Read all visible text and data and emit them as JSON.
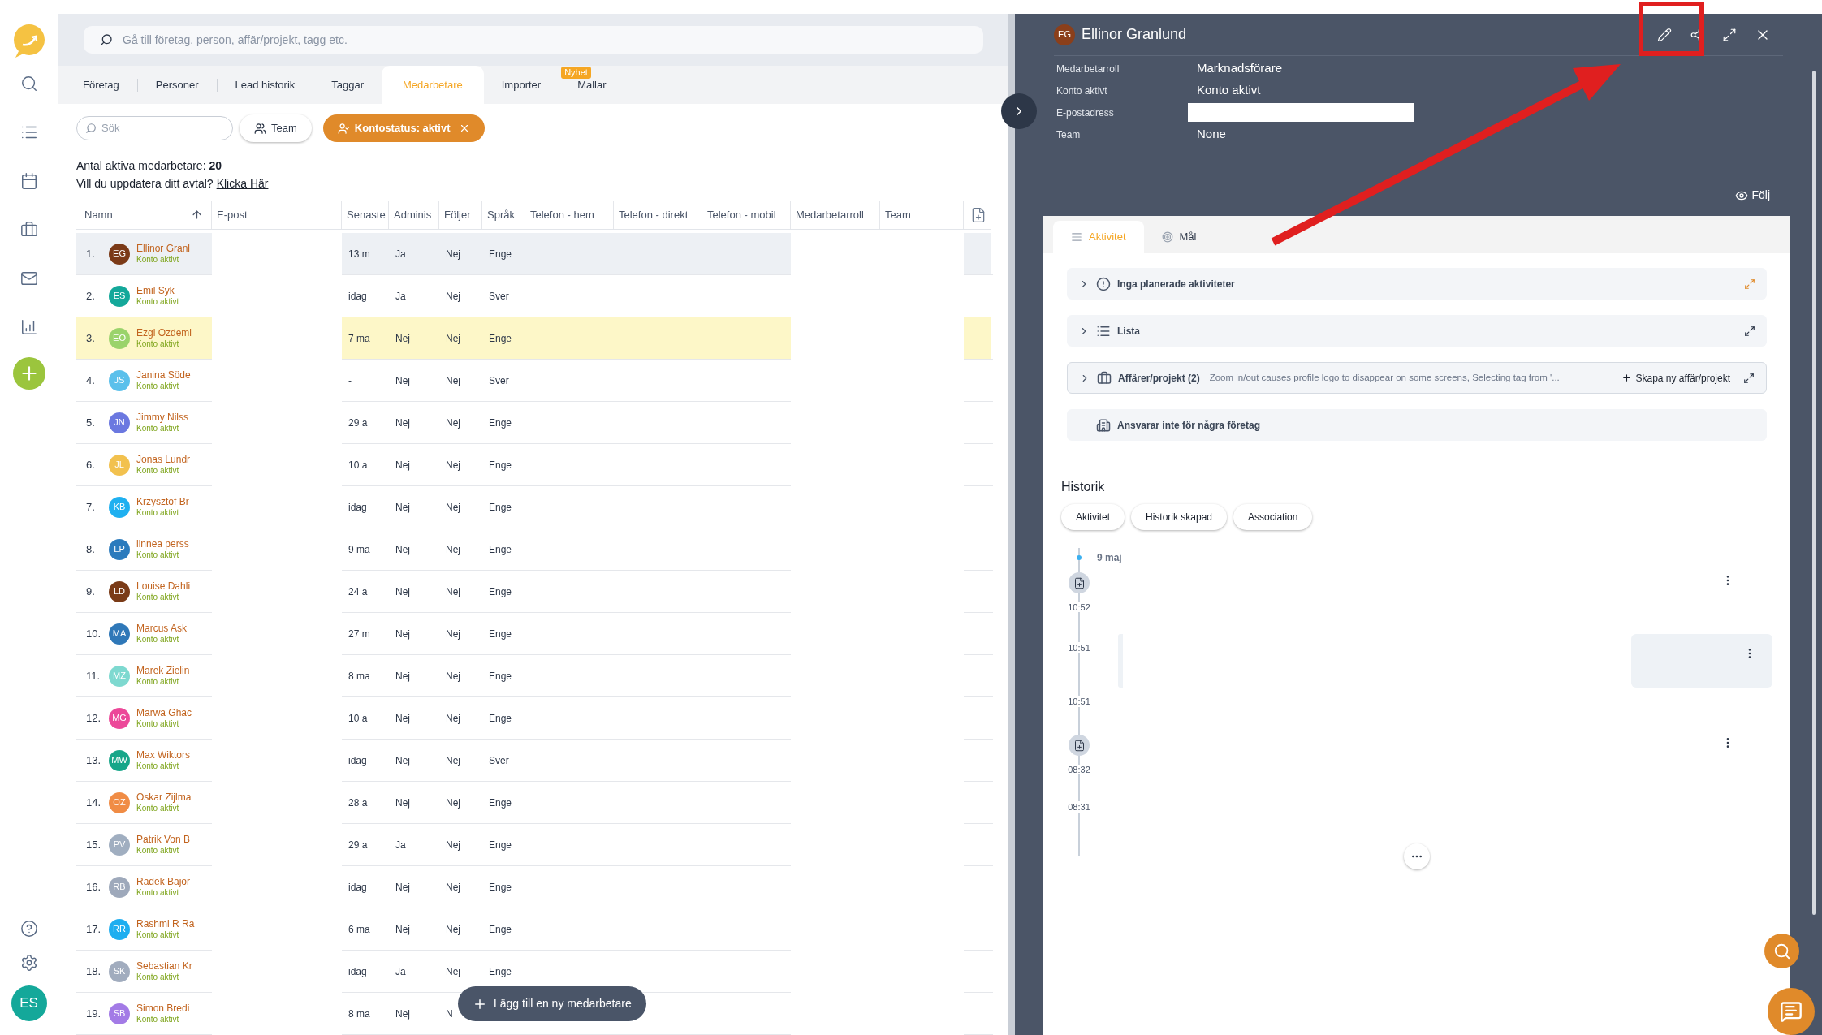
{
  "search": {
    "placeholder": "Gå till företag, person, affär/projekt, tagg etc."
  },
  "tabs": [
    {
      "label": "Företag",
      "selected": false
    },
    {
      "label": "Personer",
      "selected": false
    },
    {
      "label": "Lead historik",
      "selected": false
    },
    {
      "label": "Taggar",
      "selected": false
    },
    {
      "label": "Medarbetare",
      "selected": true
    },
    {
      "label": "Importer",
      "selected": false
    },
    {
      "label": "Mallar",
      "selected": false,
      "badge": "Nyhet"
    }
  ],
  "filters": {
    "search_placeholder": "Sök",
    "team_button": "Team",
    "status_chip": "Kontostatus: aktivt"
  },
  "summary": {
    "count": "Antal aktiva medarbetare: **20**",
    "prompt": "Vill du uppdatera ditt avtal?",
    "link": "Klicka Här"
  },
  "table": {
    "columns": [
      "Namn",
      "E-post",
      "Senaste",
      "Adminis",
      "Följer",
      "Språk",
      "Telefon - hem",
      "Telefon - direkt",
      "Telefon - mobil",
      "Medarbetarroll",
      "Team"
    ],
    "rows": [
      {
        "number": "1.",
        "initials": "EG",
        "color": "#7b3a17",
        "name": "Ellinor Granl",
        "status": "Konto aktivt",
        "last": "13 m",
        "admin": "Ja",
        "follows": "Nej",
        "language": "Enge",
        "selected": true,
        "highlighted": false
      },
      {
        "number": "2.",
        "initials": "ES",
        "color": "#14a89a",
        "name": "Emil Syk",
        "status": "Konto aktivt",
        "last": "idag",
        "admin": "Ja",
        "follows": "Nej",
        "language": "Sver",
        "selected": false,
        "highlighted": false
      },
      {
        "number": "3.",
        "initials": "EO",
        "color": "#9ad36b",
        "name": "Ezgi Ozdemi",
        "status": "Konto aktivt",
        "last": "7 ma",
        "admin": "Nej",
        "follows": "Nej",
        "language": "Enge",
        "selected": false,
        "highlighted": true
      },
      {
        "number": "4.",
        "initials": "JS",
        "color": "#5bc0eb",
        "name": "Janina Söde",
        "status": "Konto aktivt",
        "last": "-",
        "admin": "Nej",
        "follows": "Nej",
        "language": "Sver",
        "selected": false,
        "highlighted": false
      },
      {
        "number": "5.",
        "initials": "JN",
        "color": "#6b78e0",
        "name": "Jimmy Nilss",
        "status": "Konto aktivt",
        "last": "29 a",
        "admin": "Nej",
        "follows": "Nej",
        "language": "Enge",
        "selected": false,
        "highlighted": false
      },
      {
        "number": "6.",
        "initials": "JL",
        "color": "#f2c14e",
        "name": "Jonas Lundr",
        "status": "Konto aktivt",
        "last": "10 a",
        "admin": "Nej",
        "follows": "Nej",
        "language": "Enge",
        "selected": false,
        "highlighted": false
      },
      {
        "number": "7.",
        "initials": "KB",
        "color": "#1fb0f0",
        "name": "Krzysztof Br",
        "status": "Konto aktivt",
        "last": "idag",
        "admin": "Nej",
        "follows": "Nej",
        "language": "Enge",
        "selected": false,
        "highlighted": false
      },
      {
        "number": "8.",
        "initials": "LP",
        "color": "#2b7bbd",
        "name": "linnea perss",
        "status": "Konto aktivt",
        "last": "9 ma",
        "admin": "Nej",
        "follows": "Nej",
        "language": "Enge",
        "selected": false,
        "highlighted": false
      },
      {
        "number": "9.",
        "initials": "LD",
        "color": "#7a3b17",
        "name": "Louise Dahli",
        "status": "Konto aktivt",
        "last": "24 a",
        "admin": "Nej",
        "follows": "Nej",
        "language": "Enge",
        "selected": false,
        "highlighted": false
      },
      {
        "number": "10.",
        "initials": "MA",
        "color": "#2f78b8",
        "name": "Marcus Ask",
        "status": "Konto aktivt",
        "last": "27 m",
        "admin": "Nej",
        "follows": "Nej",
        "language": "Enge",
        "selected": false,
        "highlighted": false
      },
      {
        "number": "11.",
        "initials": "MZ",
        "color": "#7ed9d0",
        "name": "Marek Zielin",
        "status": "Konto aktivt",
        "last": "8 ma",
        "admin": "Nej",
        "follows": "Nej",
        "language": "Enge",
        "selected": false,
        "highlighted": false
      },
      {
        "number": "12.",
        "initials": "MG",
        "color": "#ec4899",
        "name": "Marwa Ghac",
        "status": "Konto aktivt",
        "last": "10 a",
        "admin": "Nej",
        "follows": "Nej",
        "language": "Enge",
        "selected": false,
        "highlighted": false
      },
      {
        "number": "13.",
        "initials": "MW",
        "color": "#17a689",
        "name": "Max Wiktors",
        "status": "Konto aktivt",
        "last": "idag",
        "admin": "Nej",
        "follows": "Nej",
        "language": "Sver",
        "selected": false,
        "highlighted": false
      },
      {
        "number": "14.",
        "initials": "OZ",
        "color": "#f08c45",
        "name": "Oskar Zijlma",
        "status": "Konto aktivt",
        "last": "28 a",
        "admin": "Nej",
        "follows": "Nej",
        "language": "Enge",
        "selected": false,
        "highlighted": false
      },
      {
        "number": "15.",
        "initials": "PV",
        "color": "#a0aec0",
        "name": "Patrik Von B",
        "status": "Konto aktivt",
        "last": "29 a",
        "admin": "Ja",
        "follows": "Nej",
        "language": "Enge",
        "selected": false,
        "highlighted": false
      },
      {
        "number": "16.",
        "initials": "RB",
        "color": "#9ea9bb",
        "name": "Radek Bajor",
        "status": "Konto aktivt",
        "last": "idag",
        "admin": "Nej",
        "follows": "Nej",
        "language": "Enge",
        "selected": false,
        "highlighted": false
      },
      {
        "number": "17.",
        "initials": "RR",
        "color": "#1eaef0",
        "name": "Rashmi R Ra",
        "status": "Konto aktivt",
        "last": "6 ma",
        "admin": "Nej",
        "follows": "Nej",
        "language": "Enge",
        "selected": false,
        "highlighted": false
      },
      {
        "number": "18.",
        "initials": "SK",
        "color": "#a1acbe",
        "name": "Sebastian Kr",
        "status": "Konto aktivt",
        "last": "idag",
        "admin": "Ja",
        "follows": "Nej",
        "language": "Enge",
        "selected": false,
        "highlighted": false
      },
      {
        "number": "19.",
        "initials": "SB",
        "color": "#a37be6",
        "name": "Simon Bredi",
        "status": "Konto aktivt",
        "last": "8 ma",
        "admin": "Nej",
        "follows": "N",
        "selected": false,
        "highlighted": false
      }
    ]
  },
  "add_button": "Lägg till en ny medarbetare",
  "user": {
    "initials": "ES"
  },
  "panel": {
    "initials": "EG",
    "name": "Ellinor Granlund",
    "fields": [
      {
        "label": "Medarbetarroll",
        "value": "Marknadsförare",
        "kind": "text"
      },
      {
        "label": "Konto aktivt",
        "value": "Konto aktivt",
        "kind": "text"
      },
      {
        "label": "E-postadress",
        "kind": "redacted"
      },
      {
        "label": "Team",
        "value": "None",
        "kind": "text"
      }
    ],
    "follow": "Följ",
    "tabs": [
      {
        "label": "Aktivitet",
        "selected": true
      },
      {
        "label": "Mål",
        "selected": false
      }
    ],
    "sections": [
      {
        "kind": "planned",
        "title": "Inga planerade aktiviteter"
      },
      {
        "kind": "list",
        "title": "Lista"
      },
      {
        "kind": "deals",
        "title": "Affärer/projekt (2)",
        "summary": "Zoom in/out causes profile logo to disappear on some screens, Selecting tag from '...",
        "action": "Skapa ny affär/projekt"
      },
      {
        "kind": "companies",
        "title": "Ansvarar inte för några företag"
      }
    ],
    "history": {
      "title": "Historik",
      "filters": [
        "Aktivitet",
        "Historik skapad",
        "Association"
      ],
      "date": "9 maj",
      "entries": [
        {
          "time": "10:52",
          "kind": "document"
        },
        {
          "time": "10:51",
          "kind": "note"
        },
        {
          "time": "10:51",
          "kind": "plain"
        },
        {
          "time": "08:32",
          "kind": "document"
        },
        {
          "time": "08:31",
          "kind": "plain"
        }
      ]
    }
  }
}
